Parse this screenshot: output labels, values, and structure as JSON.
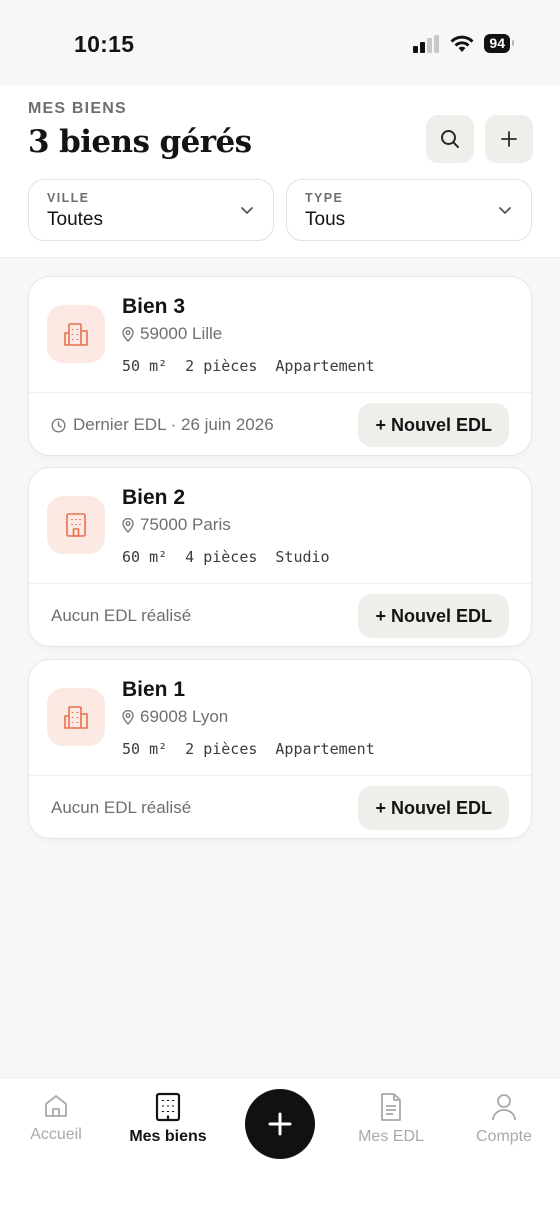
{
  "status": {
    "time": "10:15",
    "battery": "94"
  },
  "header": {
    "eyebrow": "MES BIENS",
    "title": "3 biens gérés",
    "filters": [
      {
        "label": "VILLE",
        "value": "Toutes"
      },
      {
        "label": "TYPE",
        "value": "Tous"
      }
    ]
  },
  "properties": [
    {
      "name": "Bien 3",
      "location": "59000 Lille",
      "area": "50 m²",
      "rooms": "2 pièces",
      "type": "Appartement",
      "footer": "Dernier EDL · 26 juin 2026",
      "action": "+ Nouvel EDL",
      "icon": "apartment-building-icon"
    },
    {
      "name": "Bien 2",
      "location": "75000 Paris",
      "area": "60 m²",
      "rooms": "4 pièces",
      "type": "Studio",
      "footer": "Aucun EDL réalisé",
      "action": "+ Nouvel EDL",
      "icon": "studio-building-icon"
    },
    {
      "name": "Bien 1",
      "location": "69008 Lyon",
      "area": "50 m²",
      "rooms": "2 pièces",
      "type": "Appartement",
      "footer": "Aucun EDL réalisé",
      "action": "+ Nouvel EDL",
      "icon": "apartment-building-icon"
    }
  ],
  "tabbar": {
    "items": [
      {
        "label": "Accueil",
        "icon": "home-icon"
      },
      {
        "label": "Mes biens",
        "icon": "building-icon"
      },
      {
        "label": "Mes EDL",
        "icon": "document-icon"
      },
      {
        "label": "Compte",
        "icon": "user-icon"
      }
    ]
  },
  "colors": {
    "accent": "#e8704f",
    "accent_bg": "#fde9e3",
    "primary": "#111111"
  }
}
